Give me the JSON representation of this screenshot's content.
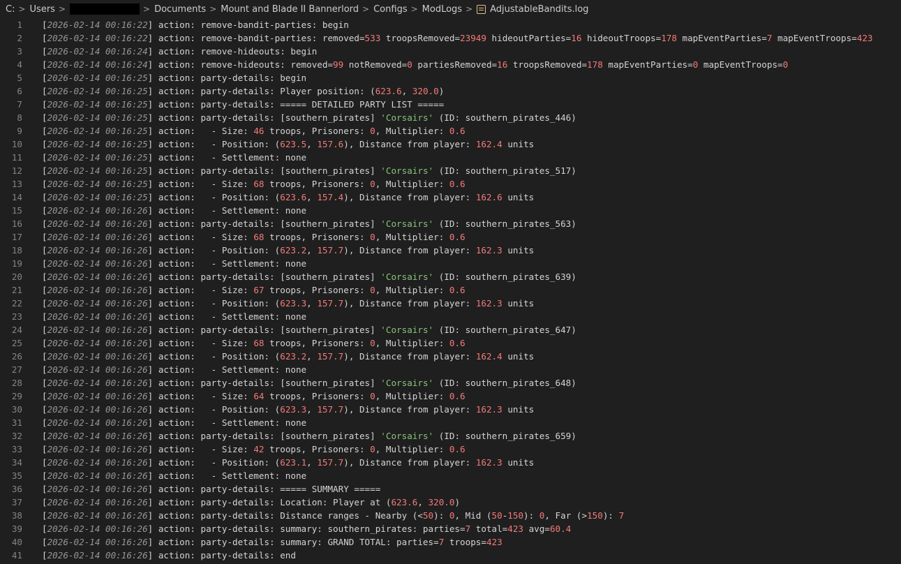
{
  "breadcrumb": [
    "C:",
    "Users",
    "Documents",
    "Mount and Blade II Bannerlord",
    "Configs",
    "ModLogs",
    "AdjustableBandits.log"
  ],
  "colors": {
    "background": "#1f1f1f",
    "text": "#d4d4d4",
    "timestamp": "#969696",
    "number": "#f47a7a",
    "string": "#89c37a",
    "line_number": "#858585"
  },
  "lines": [
    "[2026-02-14 00:16:22] action: remove-bandit-parties: begin",
    "[2026-02-14 00:16:22] action: remove-bandit-parties: removed=533 troopsRemoved=23949 hideoutParties=16 hideoutTroops=178 mapEventParties=7 mapEventTroops=423",
    "[2026-02-14 00:16:24] action: remove-hideouts: begin",
    "[2026-02-14 00:16:24] action: remove-hideouts: removed=99 notRemoved=0 partiesRemoved=16 troopsRemoved=178 mapEventParties=0 mapEventTroops=0",
    "[2026-02-14 00:16:25] action: party-details: begin",
    "[2026-02-14 00:16:25] action: party-details: Player position: (623.6, 320.0)",
    "[2026-02-14 00:16:25] action: party-details: ===== DETAILED PARTY LIST =====",
    "[2026-02-14 00:16:25] action: party-details: [southern_pirates] 'Corsairs' (ID: southern_pirates_446)",
    "[2026-02-14 00:16:25] action:   - Size: 46 troops, Prisoners: 0, Multiplier: 0.6",
    "[2026-02-14 00:16:25] action:   - Position: (623.5, 157.6), Distance from player: 162.4 units",
    "[2026-02-14 00:16:25] action:   - Settlement: none",
    "[2026-02-14 00:16:25] action: party-details: [southern_pirates] 'Corsairs' (ID: southern_pirates_517)",
    "[2026-02-14 00:16:25] action:   - Size: 68 troops, Prisoners: 0, Multiplier: 0.6",
    "[2026-02-14 00:16:25] action:   - Position: (623.6, 157.4), Distance from player: 162.6 units",
    "[2026-02-14 00:16:26] action:   - Settlement: none",
    "[2026-02-14 00:16:26] action: party-details: [southern_pirates] 'Corsairs' (ID: southern_pirates_563)",
    "[2026-02-14 00:16:26] action:   - Size: 68 troops, Prisoners: 0, Multiplier: 0.6",
    "[2026-02-14 00:16:26] action:   - Position: (623.2, 157.7), Distance from player: 162.3 units",
    "[2026-02-14 00:16:26] action:   - Settlement: none",
    "[2026-02-14 00:16:26] action: party-details: [southern_pirates] 'Corsairs' (ID: southern_pirates_639)",
    "[2026-02-14 00:16:26] action:   - Size: 67 troops, Prisoners: 0, Multiplier: 0.6",
    "[2026-02-14 00:16:26] action:   - Position: (623.3, 157.7), Distance from player: 162.3 units",
    "[2026-02-14 00:16:26] action:   - Settlement: none",
    "[2026-02-14 00:16:26] action: party-details: [southern_pirates] 'Corsairs' (ID: southern_pirates_647)",
    "[2026-02-14 00:16:26] action:   - Size: 68 troops, Prisoners: 0, Multiplier: 0.6",
    "[2026-02-14 00:16:26] action:   - Position: (623.2, 157.7), Distance from player: 162.4 units",
    "[2026-02-14 00:16:26] action:   - Settlement: none",
    "[2026-02-14 00:16:26] action: party-details: [southern_pirates] 'Corsairs' (ID: southern_pirates_648)",
    "[2026-02-14 00:16:26] action:   - Size: 64 troops, Prisoners: 0, Multiplier: 0.6",
    "[2026-02-14 00:16:26] action:   - Position: (623.3, 157.7), Distance from player: 162.3 units",
    "[2026-02-14 00:16:26] action:   - Settlement: none",
    "[2026-02-14 00:16:26] action: party-details: [southern_pirates] 'Corsairs' (ID: southern_pirates_659)",
    "[2026-02-14 00:16:26] action:   - Size: 42 troops, Prisoners: 0, Multiplier: 0.6",
    "[2026-02-14 00:16:26] action:   - Position: (623.1, 157.7), Distance from player: 162.3 units",
    "[2026-02-14 00:16:26] action:   - Settlement: none",
    "[2026-02-14 00:16:26] action: party-details: ===== SUMMARY =====",
    "[2026-02-14 00:16:26] action: party-details: Location: Player at (623.6, 320.0)",
    "[2026-02-14 00:16:26] action: party-details: Distance ranges - Nearby (<50): 0, Mid (50-150): 0, Far (>150): 7",
    "[2026-02-14 00:16:26] action: party-details: summary: southern_pirates: parties=7 total=423 avg=60.4",
    "[2026-02-14 00:16:26] action: party-details: summary: GRAND TOTAL: parties=7 troops=423",
    "[2026-02-14 00:16:26] action: party-details: end"
  ]
}
